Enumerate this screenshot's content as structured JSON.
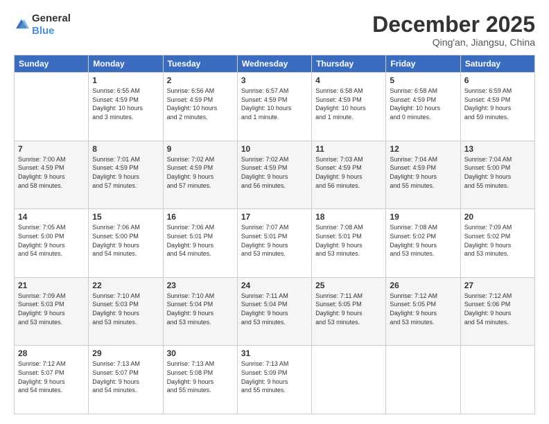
{
  "logo": {
    "general": "General",
    "blue": "Blue"
  },
  "header": {
    "month": "December 2025",
    "location": "Qing'an, Jiangsu, China"
  },
  "weekdays": [
    "Sunday",
    "Monday",
    "Tuesday",
    "Wednesday",
    "Thursday",
    "Friday",
    "Saturday"
  ],
  "weeks": [
    [
      {
        "day": "",
        "info": ""
      },
      {
        "day": "1",
        "info": "Sunrise: 6:55 AM\nSunset: 4:59 PM\nDaylight: 10 hours\nand 3 minutes."
      },
      {
        "day": "2",
        "info": "Sunrise: 6:56 AM\nSunset: 4:59 PM\nDaylight: 10 hours\nand 2 minutes."
      },
      {
        "day": "3",
        "info": "Sunrise: 6:57 AM\nSunset: 4:59 PM\nDaylight: 10 hours\nand 1 minute."
      },
      {
        "day": "4",
        "info": "Sunrise: 6:58 AM\nSunset: 4:59 PM\nDaylight: 10 hours\nand 1 minute."
      },
      {
        "day": "5",
        "info": "Sunrise: 6:58 AM\nSunset: 4:59 PM\nDaylight: 10 hours\nand 0 minutes."
      },
      {
        "day": "6",
        "info": "Sunrise: 6:59 AM\nSunset: 4:59 PM\nDaylight: 9 hours\nand 59 minutes."
      }
    ],
    [
      {
        "day": "7",
        "info": "Sunrise: 7:00 AM\nSunset: 4:59 PM\nDaylight: 9 hours\nand 58 minutes."
      },
      {
        "day": "8",
        "info": "Sunrise: 7:01 AM\nSunset: 4:59 PM\nDaylight: 9 hours\nand 57 minutes."
      },
      {
        "day": "9",
        "info": "Sunrise: 7:02 AM\nSunset: 4:59 PM\nDaylight: 9 hours\nand 57 minutes."
      },
      {
        "day": "10",
        "info": "Sunrise: 7:02 AM\nSunset: 4:59 PM\nDaylight: 9 hours\nand 56 minutes."
      },
      {
        "day": "11",
        "info": "Sunrise: 7:03 AM\nSunset: 4:59 PM\nDaylight: 9 hours\nand 56 minutes."
      },
      {
        "day": "12",
        "info": "Sunrise: 7:04 AM\nSunset: 4:59 PM\nDaylight: 9 hours\nand 55 minutes."
      },
      {
        "day": "13",
        "info": "Sunrise: 7:04 AM\nSunset: 5:00 PM\nDaylight: 9 hours\nand 55 minutes."
      }
    ],
    [
      {
        "day": "14",
        "info": "Sunrise: 7:05 AM\nSunset: 5:00 PM\nDaylight: 9 hours\nand 54 minutes."
      },
      {
        "day": "15",
        "info": "Sunrise: 7:06 AM\nSunset: 5:00 PM\nDaylight: 9 hours\nand 54 minutes."
      },
      {
        "day": "16",
        "info": "Sunrise: 7:06 AM\nSunset: 5:01 PM\nDaylight: 9 hours\nand 54 minutes."
      },
      {
        "day": "17",
        "info": "Sunrise: 7:07 AM\nSunset: 5:01 PM\nDaylight: 9 hours\nand 53 minutes."
      },
      {
        "day": "18",
        "info": "Sunrise: 7:08 AM\nSunset: 5:01 PM\nDaylight: 9 hours\nand 53 minutes."
      },
      {
        "day": "19",
        "info": "Sunrise: 7:08 AM\nSunset: 5:02 PM\nDaylight: 9 hours\nand 53 minutes."
      },
      {
        "day": "20",
        "info": "Sunrise: 7:09 AM\nSunset: 5:02 PM\nDaylight: 9 hours\nand 53 minutes."
      }
    ],
    [
      {
        "day": "21",
        "info": "Sunrise: 7:09 AM\nSunset: 5:03 PM\nDaylight: 9 hours\nand 53 minutes."
      },
      {
        "day": "22",
        "info": "Sunrise: 7:10 AM\nSunset: 5:03 PM\nDaylight: 9 hours\nand 53 minutes."
      },
      {
        "day": "23",
        "info": "Sunrise: 7:10 AM\nSunset: 5:04 PM\nDaylight: 9 hours\nand 53 minutes."
      },
      {
        "day": "24",
        "info": "Sunrise: 7:11 AM\nSunset: 5:04 PM\nDaylight: 9 hours\nand 53 minutes."
      },
      {
        "day": "25",
        "info": "Sunrise: 7:11 AM\nSunset: 5:05 PM\nDaylight: 9 hours\nand 53 minutes."
      },
      {
        "day": "26",
        "info": "Sunrise: 7:12 AM\nSunset: 5:05 PM\nDaylight: 9 hours\nand 53 minutes."
      },
      {
        "day": "27",
        "info": "Sunrise: 7:12 AM\nSunset: 5:06 PM\nDaylight: 9 hours\nand 54 minutes."
      }
    ],
    [
      {
        "day": "28",
        "info": "Sunrise: 7:12 AM\nSunset: 5:07 PM\nDaylight: 9 hours\nand 54 minutes."
      },
      {
        "day": "29",
        "info": "Sunrise: 7:13 AM\nSunset: 5:07 PM\nDaylight: 9 hours\nand 54 minutes."
      },
      {
        "day": "30",
        "info": "Sunrise: 7:13 AM\nSunset: 5:08 PM\nDaylight: 9 hours\nand 55 minutes."
      },
      {
        "day": "31",
        "info": "Sunrise: 7:13 AM\nSunset: 5:09 PM\nDaylight: 9 hours\nand 55 minutes."
      },
      {
        "day": "",
        "info": ""
      },
      {
        "day": "",
        "info": ""
      },
      {
        "day": "",
        "info": ""
      }
    ]
  ]
}
